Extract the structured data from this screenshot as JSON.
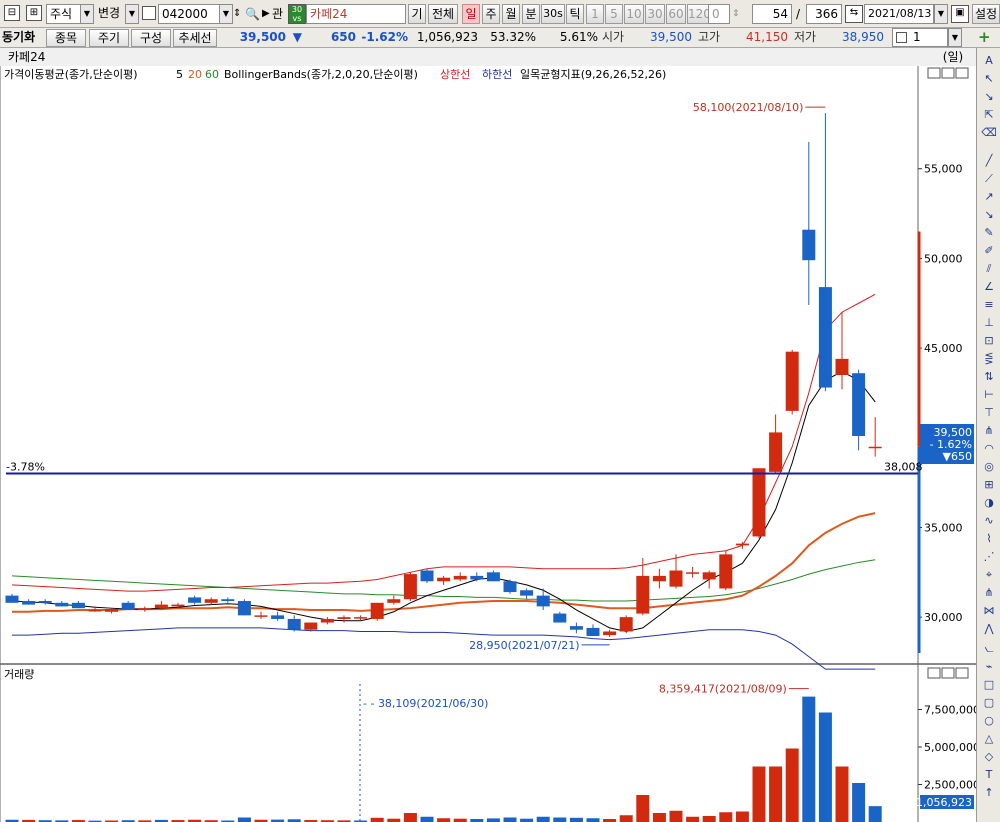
{
  "toolbar": {
    "market": "주식",
    "change": "변경",
    "code": "042000",
    "relation": "관",
    "stock_name": "카페24",
    "k_btn": "기",
    "all_btn": "전체",
    "periods": [
      "일",
      "주",
      "월",
      "분",
      "30s",
      "틱"
    ],
    "active_period": "일",
    "intervals": [
      "1",
      "5",
      "10",
      "30",
      "60",
      "120"
    ],
    "zero": "0",
    "count": "54",
    "slash": "/",
    "total": "366",
    "date": "2021/08/13",
    "settings": "설정"
  },
  "toolbar2": {
    "sync": "동기화",
    "item_btn": "종목",
    "period_btn": "주기",
    "layout_btn": "구성",
    "trend_btn": "추세선",
    "price": "39,500",
    "arrow": "▼",
    "diff": "650",
    "pct": "-1.62%",
    "volume": "1,056,923",
    "ratio1": "53.32%",
    "ratio2": "5.61%",
    "open_label": "시가",
    "open": "39,500",
    "high_label": "고가",
    "high": "41,150",
    "low_label": "저가",
    "low": "38,950",
    "chart_count": "1",
    "add": "+"
  },
  "panel": {
    "title": "카페24",
    "unit": "(일)",
    "legend_ma": "가격이동평균(종가,단순이평)",
    "ma5": "5",
    "ma20": "20",
    "ma60": "60",
    "legend_bb": "BollingerBands(종가,2,0,20,단순이평)",
    "bb_upper": "상한선",
    "bb_lower": "하한선",
    "legend_ichimoku": "일목균형지표(9,26,26,52,26)",
    "volume_title": "거래량"
  },
  "annotations": {
    "high_mark": "58,100(2021/08/10)",
    "low_mark": "28,950(2021/07/21)",
    "vol_high_mark": "8,359,417(2021/08/09)",
    "vol_line_mark": "38,109(2021/06/30)",
    "hline_pct": "-3.78%",
    "hline_value": "38,008",
    "cur_price": "39,500",
    "cur_pct": "- 1.62%",
    "cur_diff": "▼650",
    "cur_volume": "1,056,923"
  },
  "colors": {
    "up": "#d22a0e",
    "down": "#1a64c8",
    "ma5": "#000000",
    "ma20": "#e05a1c",
    "ma60": "#2a8a2a",
    "bb_upper": "#d81f1f",
    "bb_lower": "#2233aa",
    "hline": "#1a1aa8"
  },
  "chart_data": {
    "type": "candlestick",
    "price_axis_ticks": [
      "55,000",
      "50,000",
      "45,000",
      "35,000",
      "30,000"
    ],
    "price_axis_values": [
      55000,
      50000,
      45000,
      35000,
      30000
    ],
    "volume_axis_ticks": [
      "7,500,000",
      "5,000,000",
      "2,500,000"
    ],
    "volume_axis_values": [
      7500000,
      5000000,
      2500000
    ],
    "price_range": [
      27500,
      59500
    ],
    "volume_range": [
      0,
      9200000
    ],
    "hline_value": 38008,
    "candles": [
      {
        "o": 31200,
        "h": 31300,
        "l": 30800,
        "c": 30800
      },
      {
        "o": 30900,
        "h": 31000,
        "l": 30700,
        "c": 30700
      },
      {
        "o": 30900,
        "h": 31000,
        "l": 30700,
        "c": 30800
      },
      {
        "o": 30800,
        "h": 30900,
        "l": 30600,
        "c": 30600
      },
      {
        "o": 30800,
        "h": 30900,
        "l": 30500,
        "c": 30500
      },
      {
        "o": 30400,
        "h": 30600,
        "l": 30300,
        "c": 30400
      },
      {
        "o": 30300,
        "h": 30500,
        "l": 30200,
        "c": 30450
      },
      {
        "o": 30800,
        "h": 30900,
        "l": 30400,
        "c": 30400
      },
      {
        "o": 30400,
        "h": 30600,
        "l": 30300,
        "c": 30500
      },
      {
        "o": 30500,
        "h": 30900,
        "l": 30400,
        "c": 30700
      },
      {
        "o": 30600,
        "h": 30800,
        "l": 30500,
        "c": 30700
      },
      {
        "o": 31100,
        "h": 31200,
        "l": 30700,
        "c": 30800
      },
      {
        "o": 30800,
        "h": 31100,
        "l": 30700,
        "c": 31000
      },
      {
        "o": 31000,
        "h": 31100,
        "l": 30800,
        "c": 30900
      },
      {
        "o": 30900,
        "h": 31000,
        "l": 30100,
        "c": 30100
      },
      {
        "o": 30100,
        "h": 30300,
        "l": 29900,
        "c": 30100
      },
      {
        "o": 30100,
        "h": 30300,
        "l": 29800,
        "c": 29900
      },
      {
        "o": 29900,
        "h": 30100,
        "l": 29200,
        "c": 29300
      },
      {
        "o": 29300,
        "h": 29700,
        "l": 29200,
        "c": 29700
      },
      {
        "o": 29700,
        "h": 30000,
        "l": 29600,
        "c": 29900
      },
      {
        "o": 29900,
        "h": 30100,
        "l": 29700,
        "c": 30000
      },
      {
        "o": 30000,
        "h": 30100,
        "l": 29800,
        "c": 30000
      },
      {
        "o": 29900,
        "h": 30800,
        "l": 29800,
        "c": 30800
      },
      {
        "o": 30800,
        "h": 31200,
        "l": 30700,
        "c": 31000
      },
      {
        "o": 31000,
        "h": 32500,
        "l": 30900,
        "c": 32400
      },
      {
        "o": 32600,
        "h": 32700,
        "l": 31900,
        "c": 32000
      },
      {
        "o": 32000,
        "h": 32300,
        "l": 31800,
        "c": 32200
      },
      {
        "o": 32100,
        "h": 32500,
        "l": 32000,
        "c": 32300
      },
      {
        "o": 32300,
        "h": 32500,
        "l": 32000,
        "c": 32100
      },
      {
        "o": 32500,
        "h": 32600,
        "l": 32000,
        "c": 32000
      },
      {
        "o": 32000,
        "h": 32100,
        "l": 31300,
        "c": 31400
      },
      {
        "o": 31500,
        "h": 31600,
        "l": 31000,
        "c": 31200
      },
      {
        "o": 31200,
        "h": 31600,
        "l": 30400,
        "c": 30600
      },
      {
        "o": 30200,
        "h": 30300,
        "l": 29700,
        "c": 29700
      },
      {
        "o": 29500,
        "h": 29700,
        "l": 29100,
        "c": 29300
      },
      {
        "o": 29400,
        "h": 29600,
        "l": 28950,
        "c": 28950
      },
      {
        "o": 29000,
        "h": 29300,
        "l": 28900,
        "c": 29200
      },
      {
        "o": 29200,
        "h": 30100,
        "l": 29100,
        "c": 30000
      },
      {
        "o": 30200,
        "h": 33300,
        "l": 30100,
        "c": 32300
      },
      {
        "o": 32000,
        "h": 32700,
        "l": 31600,
        "c": 32300
      },
      {
        "o": 31700,
        "h": 33500,
        "l": 31600,
        "c": 32600
      },
      {
        "o": 32500,
        "h": 32800,
        "l": 32200,
        "c": 32500
      },
      {
        "o": 32100,
        "h": 32600,
        "l": 31600,
        "c": 32500
      },
      {
        "o": 31600,
        "h": 33700,
        "l": 31500,
        "c": 33500
      },
      {
        "o": 34000,
        "h": 34200,
        "l": 33800,
        "c": 34100
      },
      {
        "o": 34500,
        "h": 38300,
        "l": 34400,
        "c": 38300
      },
      {
        "o": 38100,
        "h": 41300,
        "l": 38000,
        "c": 40300
      },
      {
        "o": 41500,
        "h": 44900,
        "l": 41300,
        "c": 44800
      },
      {
        "o": 51600,
        "h": 56500,
        "l": 47400,
        "c": 49900
      },
      {
        "o": 48400,
        "h": 58100,
        "l": 42600,
        "c": 42800
      },
      {
        "o": 43500,
        "h": 47000,
        "l": 42700,
        "c": 44400
      },
      {
        "o": 43600,
        "h": 43800,
        "l": 39300,
        "c": 40100
      },
      {
        "o": 39500,
        "h": 41150,
        "l": 38950,
        "c": 39500
      }
    ],
    "volumes": [
      [
        150000,
        "down"
      ],
      [
        140000,
        "up"
      ],
      [
        120000,
        "down"
      ],
      [
        110000,
        "down"
      ],
      [
        130000,
        "up"
      ],
      [
        90000,
        "down"
      ],
      [
        100000,
        "up"
      ],
      [
        120000,
        "down"
      ],
      [
        110000,
        "up"
      ],
      [
        140000,
        "down"
      ],
      [
        130000,
        "up"
      ],
      [
        150000,
        "up"
      ],
      [
        120000,
        "up"
      ],
      [
        100000,
        "down"
      ],
      [
        300000,
        "down"
      ],
      [
        150000,
        "up"
      ],
      [
        160000,
        "down"
      ],
      [
        180000,
        "down"
      ],
      [
        130000,
        "up"
      ],
      [
        120000,
        "up"
      ],
      [
        110000,
        "up"
      ],
      [
        100000,
        "down"
      ],
      [
        280000,
        "up"
      ],
      [
        220000,
        "up"
      ],
      [
        600000,
        "up"
      ],
      [
        350000,
        "down"
      ],
      [
        250000,
        "up"
      ],
      [
        220000,
        "up"
      ],
      [
        200000,
        "down"
      ],
      [
        240000,
        "down"
      ],
      [
        300000,
        "down"
      ],
      [
        220000,
        "down"
      ],
      [
        350000,
        "down"
      ],
      [
        300000,
        "down"
      ],
      [
        280000,
        "down"
      ],
      [
        250000,
        "down"
      ],
      [
        200000,
        "up"
      ],
      [
        450000,
        "up"
      ],
      [
        1800000,
        "up"
      ],
      [
        600000,
        "up"
      ],
      [
        750000,
        "up"
      ],
      [
        350000,
        "up"
      ],
      [
        400000,
        "up"
      ],
      [
        650000,
        "up"
      ],
      [
        700000,
        "up"
      ],
      [
        3700000,
        "up"
      ],
      [
        3700000,
        "up"
      ],
      [
        4900000,
        "up"
      ],
      [
        8359417,
        "down"
      ],
      [
        7300000,
        "down"
      ],
      [
        3700000,
        "up"
      ],
      [
        2600000,
        "down"
      ],
      [
        1056923,
        "down"
      ]
    ],
    "ma5": [
      30900,
      30850,
      30800,
      30700,
      30650,
      30550,
      30500,
      30450,
      30450,
      30500,
      30550,
      30650,
      30700,
      30750,
      30700,
      30600,
      30400,
      30200,
      30000,
      29850,
      29800,
      29800,
      30000,
      30300,
      30800,
      31200,
      31500,
      31800,
      32100,
      32200,
      32000,
      31800,
      31500,
      31000,
      30400,
      29900,
      29400,
      29200,
      29400,
      30100,
      30800,
      31500,
      32100,
      32500,
      33000,
      34300,
      36000,
      38600,
      41800,
      43200,
      43700,
      43200,
      42000
    ],
    "ma20": [
      30300,
      30300,
      30350,
      30350,
      30400,
      30400,
      30400,
      30450,
      30450,
      30450,
      30500,
      30500,
      30500,
      30550,
      30500,
      30500,
      30450,
      30450,
      30400,
      30400,
      30400,
      30350,
      30400,
      30450,
      30500,
      30600,
      30700,
      30800,
      30850,
      30900,
      30900,
      30900,
      30850,
      30800,
      30700,
      30600,
      30500,
      30500,
      30500,
      30600,
      30700,
      30800,
      30900,
      31000,
      31200,
      31700,
      32300,
      33000,
      34000,
      34700,
      35200,
      35600,
      35800
    ],
    "ma60": [
      32300,
      32250,
      32200,
      32150,
      32100,
      32050,
      32000,
      31950,
      31900,
      31850,
      31800,
      31750,
      31700,
      31650,
      31600,
      31550,
      31500,
      31450,
      31400,
      31350,
      31300,
      31300,
      31250,
      31250,
      31200,
      31200,
      31150,
      31150,
      31100,
      31100,
      31050,
      31000,
      31000,
      30950,
      30950,
      30900,
      30900,
      30900,
      30950,
      31000,
      31050,
      31100,
      31150,
      31250,
      31400,
      31600,
      31850,
      32100,
      32400,
      32650,
      32850,
      33050,
      33200
    ],
    "bb_upper": [
      31800,
      31750,
      31700,
      31650,
      31600,
      31550,
      31500,
      31450,
      31450,
      31500,
      31550,
      31600,
      31650,
      31650,
      31700,
      31750,
      31800,
      31850,
      31900,
      31900,
      31950,
      32000,
      32100,
      32300,
      32500,
      32700,
      32800,
      32800,
      32800,
      32800,
      32800,
      32750,
      32700,
      32700,
      32700,
      32700,
      32700,
      32750,
      32900,
      33100,
      33300,
      33500,
      33600,
      33700,
      34000,
      35500,
      37500,
      39500,
      42500,
      46000,
      47000,
      47500,
      48000
    ],
    "bb_lower": [
      29000,
      29000,
      29050,
      29100,
      29100,
      29150,
      29200,
      29250,
      29300,
      29350,
      29400,
      29400,
      29400,
      29400,
      29400,
      29400,
      29350,
      29300,
      29250,
      29250,
      29250,
      29200,
      29200,
      29200,
      29150,
      29150,
      29150,
      29100,
      29050,
      29000,
      29000,
      29000,
      29000,
      28950,
      28900,
      28800,
      28750,
      28800,
      28900,
      29000,
      29100,
      29200,
      29300,
      29300,
      29300,
      29200,
      29000,
      28500,
      27800,
      27000,
      26000,
      25000,
      24000
    ],
    "ichimoku": []
  }
}
